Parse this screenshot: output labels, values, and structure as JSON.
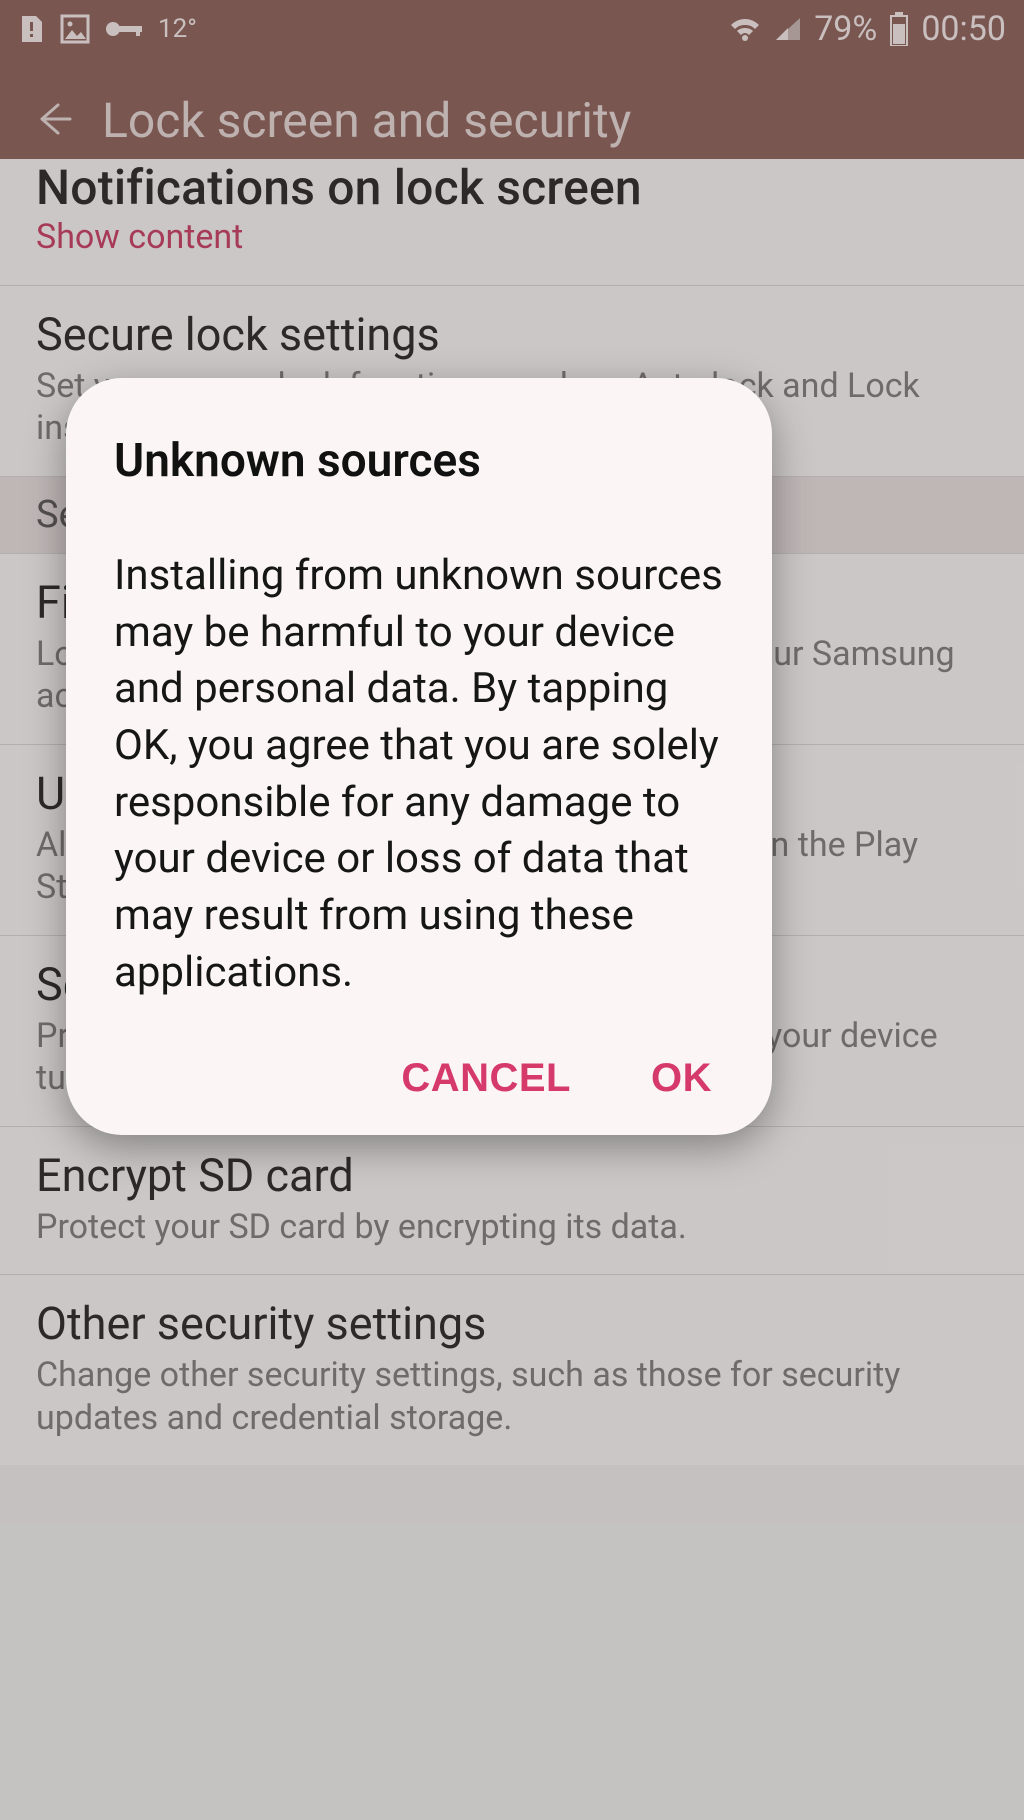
{
  "status_bar": {
    "temperature": "12°",
    "battery_percent": "79%",
    "clock": "00:50"
  },
  "app_bar": {
    "title": "Lock screen and security"
  },
  "list": {
    "notifications_item": {
      "title_partial": "Notifications on lock screen",
      "subtitle": "Show content"
    },
    "secure_lock": {
      "title": "Secure lock settings",
      "subtitle": "Set your secure lock functions, such as Auto lock and Lock instantly with Power key."
    },
    "section_security": "Security",
    "find_my_mobile": {
      "title": "Find My Mobile",
      "subtitle": "Locate and control your device remotely using your Samsung account."
    },
    "unknown_sources": {
      "title": "Unknown sources",
      "subtitle": "Allow installation of apps from sources other than the Play Store."
    },
    "secure_startup": {
      "title": "Secure startup",
      "subtitle": "Protect your device by using a screen lock when your device turns on."
    },
    "encrypt_sd": {
      "title": "Encrypt SD card",
      "subtitle": "Protect your SD card by encrypting its data."
    },
    "other_security": {
      "title": "Other security settings",
      "subtitle": "Change other security settings, such as those for security updates and credential storage."
    }
  },
  "dialog": {
    "title": "Unknown sources",
    "body": "Installing from unknown sources may be harmful to your device and personal data. By tapping OK, you agree that you are solely responsible for any damage to your device or loss of data that may result from using these applications.",
    "cancel": "CANCEL",
    "ok": "OK"
  }
}
